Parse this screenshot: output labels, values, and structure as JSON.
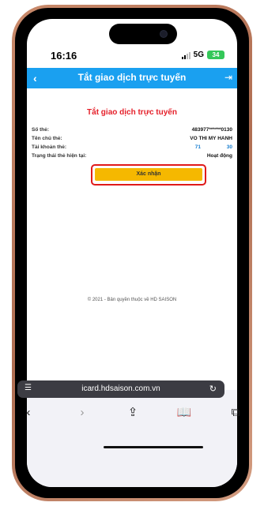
{
  "status_bar": {
    "time": "16:16",
    "network": "5G",
    "battery": "34"
  },
  "header": {
    "title": "Tắt giao dịch trực tuyến",
    "back_icon": "‹",
    "logout_icon": "⇥"
  },
  "content": {
    "title": "Tắt giao dịch trực tuyến",
    "rows": [
      {
        "label": "Số thẻ:",
        "value": "483977******0130"
      },
      {
        "label": "Tên chủ thẻ:",
        "value": "VO THI MY HANH"
      },
      {
        "label": "Tài khoản thẻ:",
        "value_a": "71",
        "value_b": "30"
      },
      {
        "label": "Trạng thái thẻ hiện tại:",
        "value": "Hoạt động"
      }
    ],
    "confirm_label": "Xác nhận",
    "copyright": "© 2021 - Bản quyền thuộc về HD SAISON"
  },
  "browser": {
    "url": "icard.hdsaison.com.vn",
    "icons": [
      "menu-icon",
      "reload-icon",
      "back-icon",
      "forward-icon",
      "share-icon",
      "bookmarks-icon",
      "tabs-icon"
    ]
  },
  "colors": {
    "header_blue": "#1aa0f0",
    "title_red": "#e5202a",
    "button_yellow": "#f5b800",
    "highlight_red": "#e01a1a",
    "link_blue": "#1a7fd0",
    "battery_green": "#34c759"
  }
}
